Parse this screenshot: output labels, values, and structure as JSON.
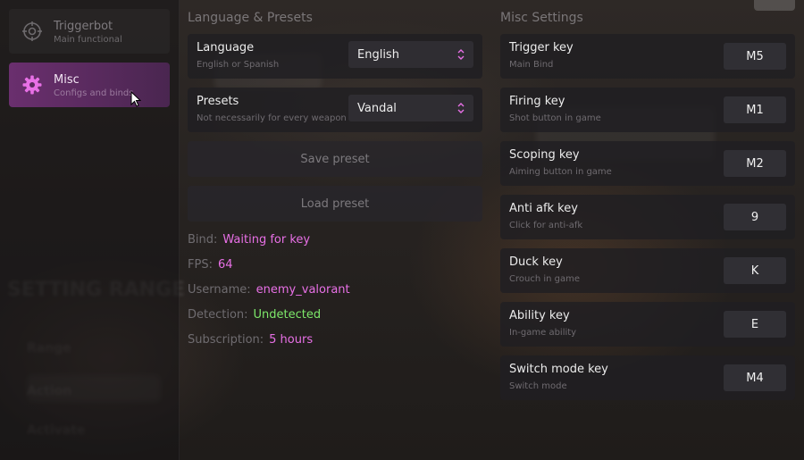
{
  "sidebar": {
    "items": [
      {
        "title": "Triggerbot",
        "subtitle": "Main functional",
        "icon": "crosshair-icon",
        "active": false
      },
      {
        "title": "Misc",
        "subtitle": "Configs and binds",
        "icon": "gear-icon",
        "active": true
      }
    ]
  },
  "language_presets": {
    "title": "Language & Presets",
    "language": {
      "label": "Language",
      "subtitle": "English or Spanish",
      "value": "English"
    },
    "presets": {
      "label": "Presets",
      "subtitle": "Not necessarily for every weapon",
      "value": "Vandal"
    },
    "save_label": "Save preset",
    "load_label": "Load preset"
  },
  "info": {
    "bind": {
      "label": "Bind:",
      "value": "Waiting for key"
    },
    "fps": {
      "label": "FPS:",
      "value": "64"
    },
    "username": {
      "label": "Username:",
      "value": "enemy_valorant"
    },
    "detection": {
      "label": "Detection:",
      "value": "Undetected"
    },
    "subscription": {
      "label": "Subscription:",
      "value": "5 hours"
    }
  },
  "misc": {
    "title": "Misc Settings",
    "keys": [
      {
        "label": "Trigger key",
        "subtitle": "Main Bind",
        "value": "M5"
      },
      {
        "label": "Firing key",
        "subtitle": "Shot button in game",
        "value": "M1"
      },
      {
        "label": "Scoping key",
        "subtitle": "Aiming button in game",
        "value": "M2"
      },
      {
        "label": "Anti afk key",
        "subtitle": "Click for anti-afk",
        "value": "9"
      },
      {
        "label": "Duck key",
        "subtitle": "Crouch in game",
        "value": "K"
      },
      {
        "label": "Ability key",
        "subtitle": "In-game ability",
        "value": "E"
      },
      {
        "label": "Switch mode key",
        "subtitle": "Switch mode",
        "value": "M4"
      }
    ]
  },
  "colors": {
    "accent": "#e870e6",
    "success": "#7de86a",
    "active_nav": "#6a2f6e"
  }
}
